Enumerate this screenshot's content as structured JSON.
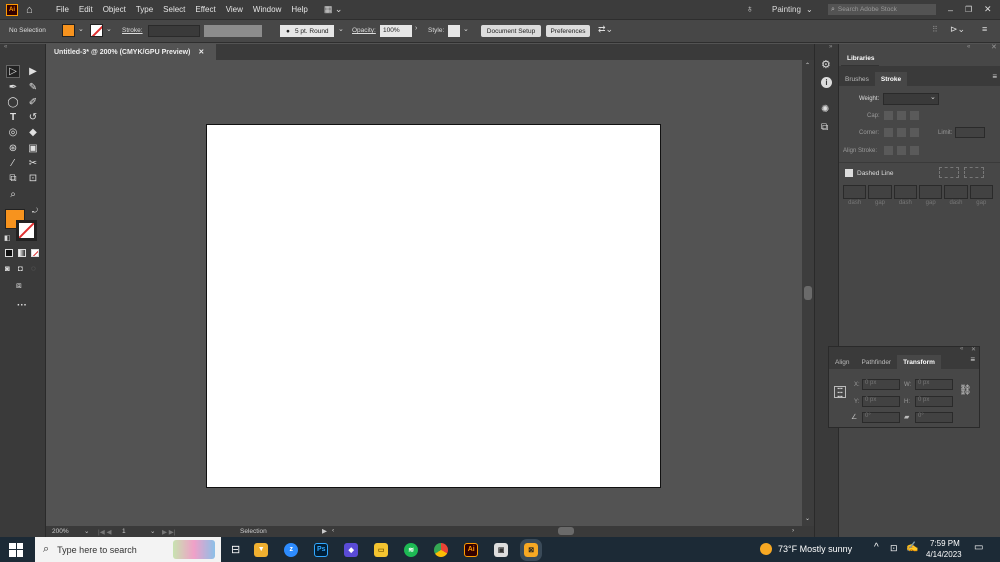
{
  "app": {
    "logo": "Ai"
  },
  "menu": [
    "File",
    "Edit",
    "Object",
    "Type",
    "Select",
    "Effect",
    "View",
    "Window",
    "Help"
  ],
  "workspace": {
    "label": "Painting",
    "search_placeholder": "Search Adobe Stock"
  },
  "control": {
    "selection": "No Selection",
    "stroke_label": "Stroke:",
    "brush": "5 pt. Round",
    "opacity_label": "Opacity:",
    "opacity_value": "100%",
    "style_label": "Style:",
    "doc_setup": "Document Setup",
    "preferences": "Preferences"
  },
  "document": {
    "tab_title": "Untitled-3* @ 200% (CMYK/GPU Preview)"
  },
  "status": {
    "zoom": "200%",
    "page": "1",
    "tool": "Selection"
  },
  "panels": {
    "libraries": "Libraries",
    "tabs": [
      "Brushes",
      "Stroke"
    ],
    "weight_label": "Weight:",
    "cap_label": "Cap:",
    "corner_label": "Corner:",
    "limit_label": "Limit:",
    "align_stroke_label": "Align Stroke:",
    "dashed_line": "Dashed Line",
    "dash_labels": [
      "dash",
      "gap",
      "dash",
      "gap",
      "dash",
      "gap"
    ]
  },
  "transform_panel": {
    "tabs": [
      "Align",
      "Pathfinder",
      "Transform"
    ],
    "x_label": "X:",
    "y_label": "Y:",
    "w_label": "W:",
    "h_label": "H:",
    "x": "0 px",
    "y": "0 px",
    "w": "0 px",
    "h": "0 px",
    "angle": "0°",
    "shear": "0°"
  },
  "taskbar": {
    "search_placeholder": "Type here to search",
    "weather": "73°F  Mostly sunny",
    "time": "7:59 PM",
    "date": "4/14/2023"
  },
  "colors": {
    "fill": "#f7931e",
    "ai_brand": "#ff9a00",
    "taskbar": "#1c2a36"
  }
}
